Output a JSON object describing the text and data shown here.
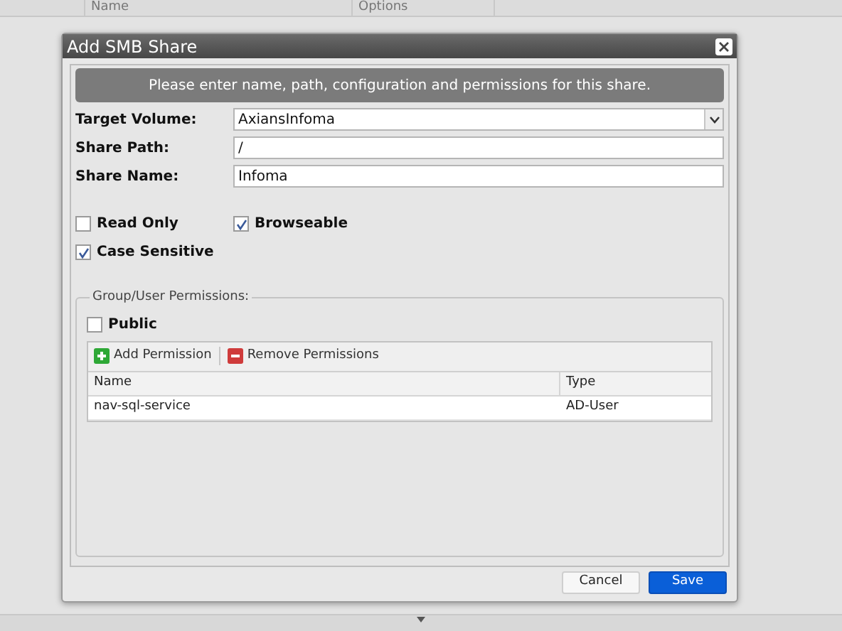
{
  "background_table": {
    "columns": [
      "Name",
      "Options"
    ]
  },
  "dialog": {
    "title": "Add SMB Share",
    "banner": "Please enter name, path, configuration and permissions for this share.",
    "fields": [
      {
        "kind": "select",
        "label": "Target Volume:",
        "value": "AxiansInfoma"
      },
      {
        "kind": "text",
        "label": "Share Path:",
        "value": "/"
      },
      {
        "kind": "text",
        "label": "Share Name:",
        "value": "Infoma"
      }
    ],
    "options": [
      {
        "label": "Read Only",
        "checked": false
      },
      {
        "label": "Browseable",
        "checked": true
      },
      {
        "label": "Case Sensitive",
        "checked": true
      }
    ],
    "permissions": {
      "legend": "Group/User Permissions:",
      "public": {
        "label": "Public",
        "checked": false
      },
      "toolbar": [
        {
          "kind": "add",
          "label": "Add Permission"
        },
        {
          "kind": "remove",
          "label": "Remove Permissions"
        }
      ],
      "columns": [
        "Name",
        "Type"
      ],
      "rows": [
        {
          "name": "nav-sql-service",
          "type": "AD-User",
          "selected": false
        }
      ]
    },
    "buttons": [
      {
        "kind": "secondary",
        "label": "Cancel"
      },
      {
        "kind": "primary",
        "label": "Save"
      }
    ]
  }
}
